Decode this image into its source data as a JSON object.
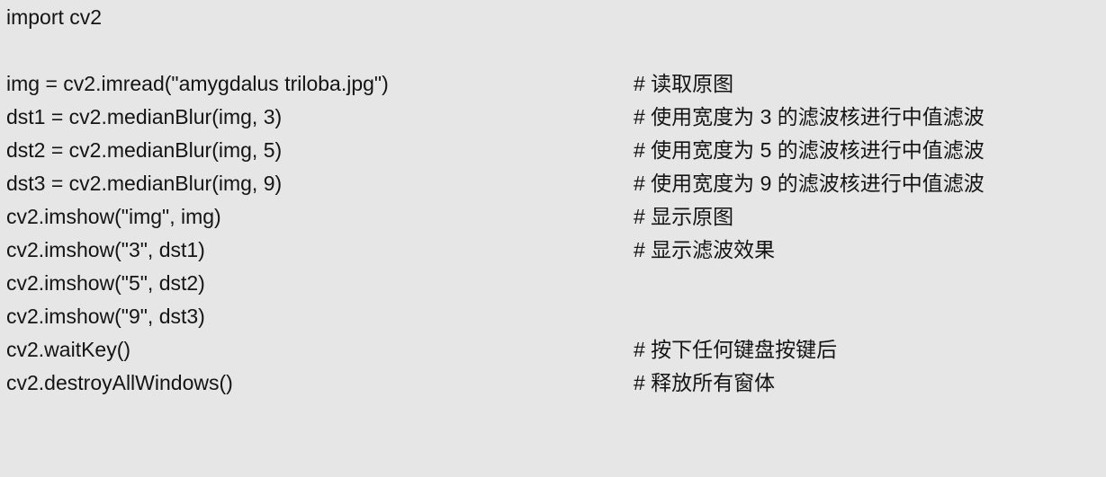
{
  "lines": [
    {
      "code": "import cv2",
      "comment": ""
    },
    {
      "code": "",
      "comment": ""
    },
    {
      "code": "img = cv2.imread(\"amygdalus triloba.jpg\")",
      "comment": "# 读取原图"
    },
    {
      "code": "dst1 = cv2.medianBlur(img, 3)",
      "comment": "# 使用宽度为 3 的滤波核进行中值滤波"
    },
    {
      "code": "dst2 = cv2.medianBlur(img, 5)",
      "comment": "# 使用宽度为 5 的滤波核进行中值滤波"
    },
    {
      "code": "dst3 = cv2.medianBlur(img, 9)",
      "comment": "# 使用宽度为 9 的滤波核进行中值滤波"
    },
    {
      "code": "cv2.imshow(\"img\", img)",
      "comment": "# 显示原图"
    },
    {
      "code": "cv2.imshow(\"3\", dst1)",
      "comment": "# 显示滤波效果"
    },
    {
      "code": "cv2.imshow(\"5\", dst2)",
      "comment": ""
    },
    {
      "code": "cv2.imshow(\"9\", dst3)",
      "comment": ""
    },
    {
      "code": "cv2.waitKey()",
      "comment": "# 按下任何键盘按键后"
    },
    {
      "code": "cv2.destroyAllWindows()",
      "comment": "# 释放所有窗体"
    }
  ]
}
